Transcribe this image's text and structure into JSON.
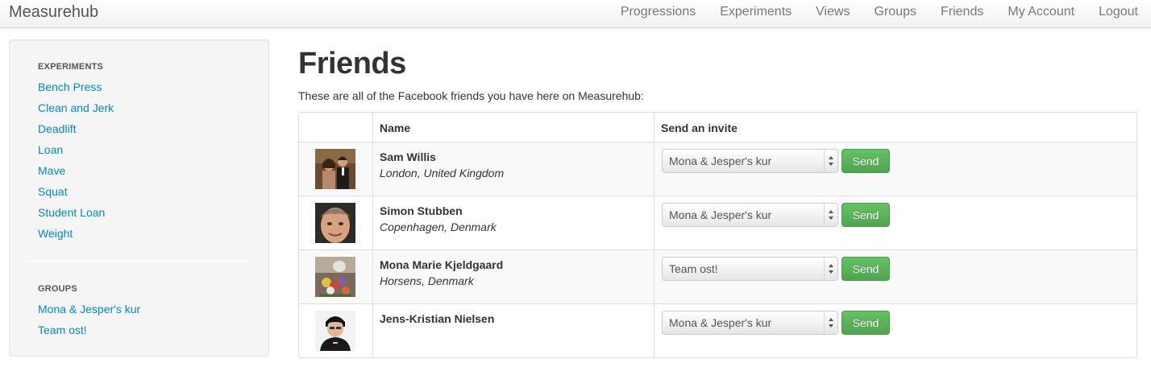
{
  "navbar": {
    "brand": "Measurehub",
    "items": [
      "Progressions",
      "Experiments",
      "Views",
      "Groups",
      "Friends",
      "My Account",
      "Logout"
    ]
  },
  "sidebar": {
    "experiments_header": "EXPERIMENTS",
    "experiments": [
      "Bench Press",
      "Clean and Jerk",
      "Deadlift",
      "Loan",
      "Mave",
      "Squat",
      "Student Loan",
      "Weight"
    ],
    "groups_header": "GROUPS",
    "groups": [
      "Mona & Jesper's kur",
      "Team ost!"
    ]
  },
  "main": {
    "title": "Friends",
    "intro": "These are all of the Facebook friends you have here on Measurehub:",
    "columns": {
      "name": "Name",
      "invite": "Send an invite"
    },
    "send_label": "Send",
    "friends": [
      {
        "name": "Sam Willis",
        "location": "London, United Kingdom",
        "selected_group": "Mona & Jesper's kur"
      },
      {
        "name": "Simon Stubben",
        "location": "Copenhagen, Denmark",
        "selected_group": "Mona & Jesper's kur"
      },
      {
        "name": "Mona Marie Kjeldgaard",
        "location": "Horsens, Denmark",
        "selected_group": "Team ost!"
      },
      {
        "name": "Jens-Kristian Nielsen",
        "location": "",
        "selected_group": "Mona & Jesper's kur"
      }
    ]
  },
  "colors": {
    "link": "#0088cc",
    "send_button": "#5bb75b",
    "stripe": "#f9f9f9"
  }
}
